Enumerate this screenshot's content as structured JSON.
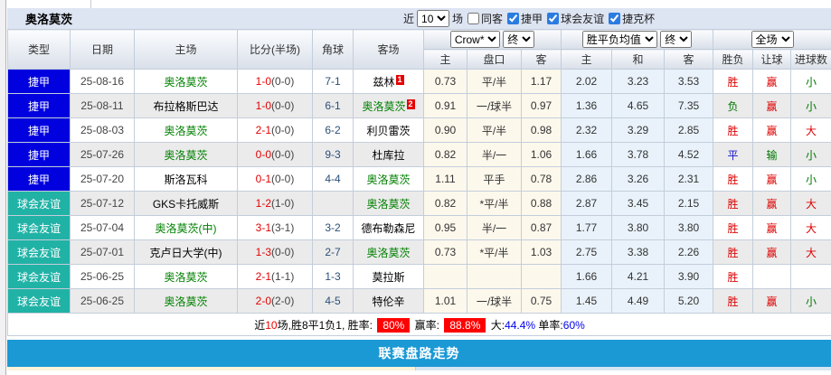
{
  "colors": {
    "league": {
      "捷甲": "#0101DF",
      "球会友谊": "#21B2A6"
    },
    "result": {
      "胜": "#DD0000",
      "平": "#1414CC",
      "负": "#007700",
      "赢": "#DD0000",
      "输": "#007700",
      "大": "#DD0000",
      "小": "#007700"
    },
    "team_green": "#008000",
    "score_red": "#E60000",
    "badge_bg": "#E60000",
    "bar_blue": "#1B99D5"
  },
  "title": "奥洛莫茨",
  "toolbar": {
    "near_label": "近",
    "match_count": "10",
    "unit_label": "场",
    "filters": [
      {
        "label": "同客",
        "checked": false
      },
      {
        "label": "捷甲",
        "checked": true
      },
      {
        "label": "球会友谊",
        "checked": true
      },
      {
        "label": "捷克杯",
        "checked": true
      }
    ]
  },
  "header": {
    "static_cols": [
      "类型",
      "日期",
      "主场",
      "比分(半场)",
      "角球",
      "客场"
    ],
    "group1_select": "Crow*",
    "group1_period": "终",
    "group2_select": "胜平负均值",
    "group2_period": "终",
    "group3_select": "全场",
    "sub_cols": [
      "主",
      "盘口",
      "客",
      "主",
      "和",
      "客",
      "胜负",
      "让球",
      "进球数"
    ]
  },
  "rows": [
    {
      "type": "捷甲",
      "date": "25-08-16",
      "home": {
        "name": "奥洛莫茨",
        "green": true,
        "badge": ""
      },
      "score": {
        "ft": "1-0",
        "ht": "(0-0)"
      },
      "corner": "7-1",
      "away": {
        "name": "兹林",
        "green": false,
        "badge": "1"
      },
      "odds": [
        "0.73",
        "平/半",
        "1.17"
      ],
      "avg": [
        "2.02",
        "3.23",
        "3.53"
      ],
      "res": [
        "胜",
        "赢",
        "小"
      ]
    },
    {
      "type": "捷甲",
      "date": "25-08-11",
      "home": {
        "name": "布拉格斯巴达",
        "green": false,
        "badge": ""
      },
      "score": {
        "ft": "1-0",
        "ht": "(0-0)"
      },
      "corner": "6-1",
      "away": {
        "name": "奥洛莫茨",
        "green": true,
        "badge": "2"
      },
      "odds": [
        "0.91",
        "一/球半",
        "0.97"
      ],
      "avg": [
        "1.36",
        "4.65",
        "7.35"
      ],
      "res": [
        "负",
        "赢",
        "小"
      ]
    },
    {
      "type": "捷甲",
      "date": "25-08-03",
      "home": {
        "name": "奥洛莫茨",
        "green": true,
        "badge": ""
      },
      "score": {
        "ft": "2-1",
        "ht": "(0-0)"
      },
      "corner": "6-2",
      "away": {
        "name": "利贝雷茨",
        "green": false,
        "badge": ""
      },
      "odds": [
        "0.90",
        "平/半",
        "0.98"
      ],
      "avg": [
        "2.32",
        "3.29",
        "2.85"
      ],
      "res": [
        "胜",
        "赢",
        "大"
      ]
    },
    {
      "type": "捷甲",
      "date": "25-07-26",
      "home": {
        "name": "奥洛莫茨",
        "green": true,
        "badge": ""
      },
      "score": {
        "ft": "0-0",
        "ht": "(0-0)"
      },
      "corner": "9-3",
      "away": {
        "name": "杜库拉",
        "green": false,
        "badge": ""
      },
      "odds": [
        "0.82",
        "半/一",
        "1.06"
      ],
      "avg": [
        "1.66",
        "3.78",
        "4.52"
      ],
      "res": [
        "平",
        "输",
        "小"
      ]
    },
    {
      "type": "捷甲",
      "date": "25-07-20",
      "home": {
        "name": "斯洛瓦科",
        "green": false,
        "badge": ""
      },
      "score": {
        "ft": "0-1",
        "ht": "(0-0)"
      },
      "corner": "4-4",
      "away": {
        "name": "奥洛莫茨",
        "green": true,
        "badge": ""
      },
      "odds": [
        "1.11",
        "平手",
        "0.78"
      ],
      "avg": [
        "2.86",
        "3.26",
        "2.31"
      ],
      "res": [
        "胜",
        "赢",
        "小"
      ]
    },
    {
      "type": "球会友谊",
      "date": "25-07-12",
      "home": {
        "name": "GKS卡托威斯",
        "green": false,
        "badge": ""
      },
      "score": {
        "ft": "1-2",
        "ht": "(1-0)"
      },
      "corner": "",
      "away": {
        "name": "奥洛莫茨",
        "green": true,
        "badge": ""
      },
      "odds": [
        "0.82",
        "*平/半",
        "0.88"
      ],
      "avg": [
        "2.87",
        "3.45",
        "2.15"
      ],
      "res": [
        "胜",
        "赢",
        "大"
      ]
    },
    {
      "type": "球会友谊",
      "date": "25-07-04",
      "home": {
        "name": "奥洛莫茨(中)",
        "green": true,
        "badge": ""
      },
      "score": {
        "ft": "3-1",
        "ht": "(3-1)"
      },
      "corner": "3-2",
      "away": {
        "name": "德布勒森尼",
        "green": false,
        "badge": ""
      },
      "odds": [
        "0.95",
        "半/一",
        "0.87"
      ],
      "avg": [
        "1.77",
        "3.80",
        "3.80"
      ],
      "res": [
        "胜",
        "赢",
        "大"
      ]
    },
    {
      "type": "球会友谊",
      "date": "25-07-01",
      "home": {
        "name": "克卢日大学(中)",
        "green": false,
        "badge": ""
      },
      "score": {
        "ft": "1-3",
        "ht": "(0-0)"
      },
      "corner": "2-7",
      "away": {
        "name": "奥洛莫茨",
        "green": true,
        "badge": ""
      },
      "odds": [
        "0.73",
        "*平/半",
        "1.03"
      ],
      "avg": [
        "2.75",
        "3.38",
        "2.26"
      ],
      "res": [
        "胜",
        "赢",
        "大"
      ]
    },
    {
      "type": "球会友谊",
      "date": "25-06-25",
      "home": {
        "name": "奥洛莫茨",
        "green": true,
        "badge": ""
      },
      "score": {
        "ft": "2-1",
        "ht": "(1-1)"
      },
      "corner": "1-3",
      "away": {
        "name": "莫拉斯",
        "green": false,
        "badge": ""
      },
      "odds": [
        "",
        "",
        ""
      ],
      "avg": [
        "1.66",
        "4.21",
        "3.90"
      ],
      "res": [
        "胜",
        "",
        ""
      ]
    },
    {
      "type": "球会友谊",
      "date": "25-06-25",
      "home": {
        "name": "奥洛莫茨",
        "green": true,
        "badge": ""
      },
      "score": {
        "ft": "2-0",
        "ht": "(2-0)"
      },
      "corner": "4-5",
      "away": {
        "name": "特伦辛",
        "green": false,
        "badge": ""
      },
      "odds": [
        "1.01",
        "一/球半",
        "0.75"
      ],
      "avg": [
        "1.45",
        "4.49",
        "5.20"
      ],
      "res": [
        "胜",
        "赢",
        "小"
      ]
    }
  ],
  "summary": {
    "parts": [
      {
        "text": "近",
        "style": "plain"
      },
      {
        "text": "10",
        "style": "red"
      },
      {
        "text": "场,胜8平1负1, 胜率: ",
        "style": "plain"
      },
      {
        "text": "80%",
        "style": "badge"
      },
      {
        "text": " 赢率: ",
        "style": "plain"
      },
      {
        "text": "88.8%",
        "style": "badge"
      },
      {
        "text": " 大:",
        "style": "plain"
      },
      {
        "text": "44.4%",
        "style": "blue"
      },
      {
        "text": " 单率:",
        "style": "plain"
      },
      {
        "text": "60%",
        "style": "blue"
      }
    ]
  },
  "footer_bar": "联赛盘路走势"
}
